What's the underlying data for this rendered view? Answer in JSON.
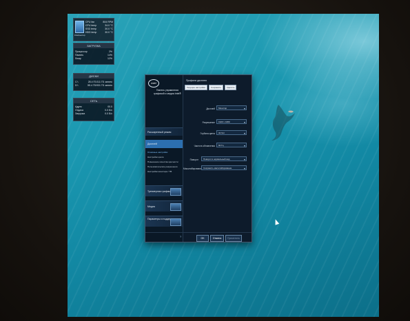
{
  "gadgets": {
    "system": {
      "pc_label": "Компьютер",
      "rows": [
        {
          "label": "CPU fan",
          "value": "804 RPM"
        },
        {
          "label": "CPU temp",
          "value": "34.0 °C"
        },
        {
          "label": "SSD temp",
          "value": "30.0 °C"
        },
        {
          "label": "HDD temp",
          "value": "30.0 °C"
        }
      ]
    },
    "load": {
      "title": "ЗАГРУЗКА",
      "rows": [
        {
          "label": "Процессор",
          "value": "2%"
        },
        {
          "label": "Память",
          "value": "14%"
        },
        {
          "label": "Swap",
          "value": "12%"
        }
      ]
    },
    "disks": {
      "title": "ДИСКИ",
      "rows": [
        {
          "label": "C:\\",
          "value": "28.4 ГБ/111 ГБ занято"
        },
        {
          "label": "D:\\",
          "value": "55.4 ГБ/931 ГБ занято"
        }
      ]
    },
    "network": {
      "title": "СЕТЬ",
      "rows": [
        {
          "label": "Адрес",
          "value": "00.0"
        },
        {
          "label": "Отдача",
          "value": "0.0 Б/с"
        },
        {
          "label": "Загрузка",
          "value": "0.0 Б/с"
        }
      ]
    }
  },
  "dialog": {
    "logo": "intel",
    "title": "Панель управления графикой и медиа Intel®",
    "sidebar": {
      "mode": "Расширенный режим",
      "display": "Дисплей",
      "subitems": [
        "Основные настройки",
        "Настройки цвета",
        "Повышение качества цветности",
        "Пользовательские разрешения",
        "Настройки монитора / ТВ"
      ],
      "sections": [
        "Трехмерная графика",
        "Медиа",
        "Параметры и поддержка"
      ]
    },
    "profile_label": "Профили дисплея",
    "tabs": [
      "Текущие настройки",
      "Сохранить",
      "Удалить"
    ],
    "fields": [
      {
        "label": "Дисплей",
        "value": "Монитор"
      },
      {
        "label": "Разрешение",
        "value": "1920 x 1080"
      },
      {
        "label": "Глубина цвета",
        "value": "32 бит"
      },
      {
        "label": "Частота обновления",
        "value": "60 Гц"
      },
      {
        "label": "Поворот",
        "value": "Поворот в нормальный вид"
      },
      {
        "label": "Масштабирование",
        "value": "Сохранить масштабирование"
      }
    ],
    "footer": {
      "help": "?",
      "ok": "OK",
      "cancel": "Отмена",
      "apply": "Применить"
    }
  }
}
